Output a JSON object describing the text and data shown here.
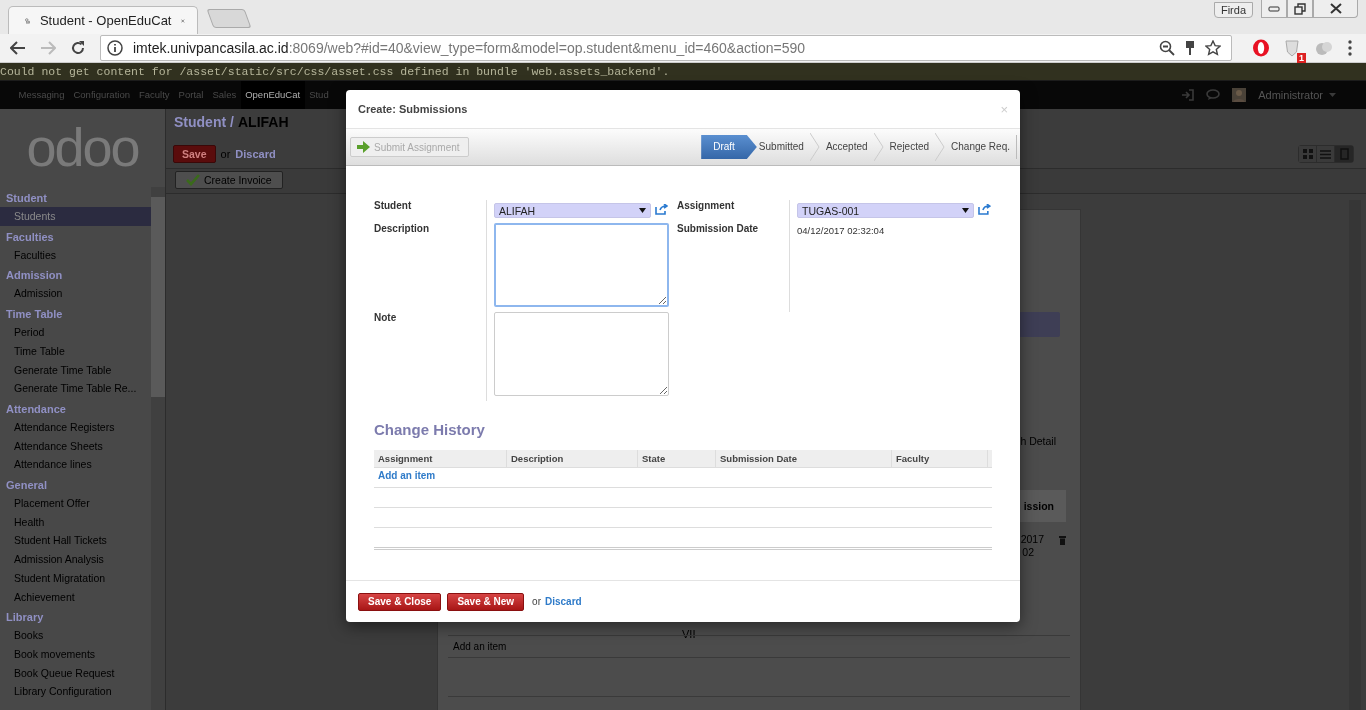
{
  "browser": {
    "tab_title": "Student - OpenEduCat",
    "profile": "Firda",
    "url_host": "imtek.univpancasila.ac.id",
    "url_rest": ":8069/web?#id=40&view_type=form&model=op.student&menu_id=460&action=590",
    "extension_badge": "1"
  },
  "error_message": "Could not get content for /asset/static/src/css/asset.css defined in bundle 'web.assets_backend'.",
  "top_menu": [
    {
      "label": "Messaging",
      "selected": false
    },
    {
      "label": "Configuration",
      "selected": false
    },
    {
      "label": "Faculty",
      "selected": false
    },
    {
      "label": "Portal",
      "selected": false
    },
    {
      "label": "Sales",
      "selected": false
    },
    {
      "label": "OpenEduCat",
      "selected": true
    },
    {
      "label": "Stud",
      "selected": false
    }
  ],
  "user": "Administrator",
  "logo": "odoo",
  "sidebar": [
    {
      "title": "Student",
      "items": [
        {
          "label": "Students",
          "selected": true
        }
      ]
    },
    {
      "title": "Faculties",
      "items": [
        {
          "label": "Faculties",
          "selected": false
        }
      ]
    },
    {
      "title": "Admission",
      "items": [
        {
          "label": "Admission",
          "selected": false
        }
      ]
    },
    {
      "title": "Time Table",
      "items": [
        {
          "label": "Period",
          "selected": false
        },
        {
          "label": "Time Table",
          "selected": false
        },
        {
          "label": "Generate Time Table",
          "selected": false
        },
        {
          "label": "Generate Time Table Re...",
          "selected": false
        }
      ]
    },
    {
      "title": "Attendance",
      "items": [
        {
          "label": "Attendance Registers",
          "selected": false
        },
        {
          "label": "Attendance Sheets",
          "selected": false
        },
        {
          "label": "Attendance lines",
          "selected": false
        }
      ]
    },
    {
      "title": "General",
      "items": [
        {
          "label": "Placement Offer",
          "selected": false
        },
        {
          "label": "Health",
          "selected": false
        },
        {
          "label": "Student Hall Tickets",
          "selected": false
        },
        {
          "label": "Admission Analysis",
          "selected": false
        },
        {
          "label": "Student Migratation",
          "selected": false
        },
        {
          "label": "Achievement",
          "selected": false
        }
      ]
    },
    {
      "title": "Library",
      "items": [
        {
          "label": "Books",
          "selected": false
        },
        {
          "label": "Book movements",
          "selected": false
        },
        {
          "label": "Book Queue Request",
          "selected": false
        },
        {
          "label": "Library Configuration",
          "selected": false
        }
      ]
    }
  ],
  "breadcrumb": {
    "parent": "Student",
    "separator": "/",
    "current": "ALIFAH"
  },
  "form_actions": {
    "save": "Save",
    "or": "or",
    "discard": "Discard"
  },
  "create_invoice": "Create Invoice",
  "background_fragments": {
    "tab_label": "h Detail",
    "column_heading": "ission",
    "cell_lines": [
      "2017",
      "02"
    ],
    "group_label": "VII",
    "add_item": "Add an item"
  },
  "modal": {
    "title": "Create: Submissions",
    "close": "×",
    "submit_button": {
      "label": "Submit Assignment",
      "disabled": true
    },
    "stages": [
      {
        "label": "Draft",
        "selected": true
      },
      {
        "label": "Submitted",
        "selected": false
      },
      {
        "label": "Accepted",
        "selected": false
      },
      {
        "label": "Rejected",
        "selected": false
      },
      {
        "label": "Change Req.",
        "selected": false
      }
    ],
    "student": {
      "label": "Student",
      "value": "ALIFAH"
    },
    "description": {
      "label": "Description",
      "focused": true
    },
    "note": {
      "label": "Note"
    },
    "assignment": {
      "label": "Assignment",
      "value": "TUGAS-001"
    },
    "submission_date": {
      "label": "Submission Date",
      "value": "04/12/2017 02:32:04"
    },
    "history": {
      "title": "Change History",
      "columns": [
        "Assignment",
        "Description",
        "State",
        "Submission Date",
        "Faculty"
      ],
      "add_item": "Add an item"
    },
    "footer": {
      "save_close": "Save & Close",
      "save_new": "Save & New",
      "or": "or",
      "discard": "Discard"
    }
  }
}
